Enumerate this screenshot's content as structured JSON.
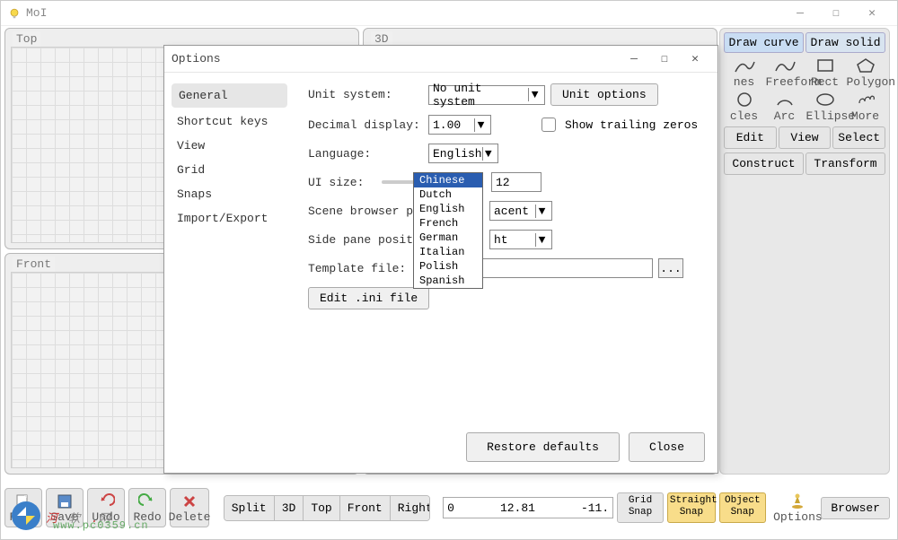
{
  "window": {
    "title": "MoI"
  },
  "viewports": {
    "top": "Top",
    "three_d": "3D",
    "front": "Front"
  },
  "sidepanel": {
    "tabs": {
      "curve": "Draw curve",
      "solid": "Draw solid"
    },
    "shapes1": [
      "nes",
      "Freeform",
      "Rect",
      "Polygon"
    ],
    "shapes2": [
      "cles",
      "Arc",
      "Ellipse",
      "More"
    ],
    "actions": {
      "edit": "Edit",
      "view": "View",
      "select": "Select",
      "construct": "Construct",
      "transform": "Transform"
    }
  },
  "bottombar": {
    "icons": [
      "File",
      "Save",
      "Undo",
      "Redo",
      "Delete"
    ],
    "views": [
      "Split",
      "3D",
      "Top",
      "Front",
      "Right"
    ],
    "coords": {
      "a": "0",
      "b": "12.81",
      "c": "-11."
    },
    "snaps": {
      "grid": "Grid\nSnap",
      "straight": "Straight\nSnap",
      "object": "Object\nSnap"
    },
    "options": "Options",
    "browser": "Browser"
  },
  "dialog": {
    "title": "Options",
    "nav": [
      "General",
      "Shortcut keys",
      "View",
      "Grid",
      "Snaps",
      "Import/Export"
    ],
    "fields": {
      "unit_system": {
        "label": "Unit system:",
        "value": "No unit system",
        "button": "Unit options"
      },
      "decimal": {
        "label": "Decimal display:",
        "value": "1.00",
        "trailing": "Show trailing zeros"
      },
      "language": {
        "label": "Language:",
        "value": "English",
        "options": [
          "Chinese",
          "Dutch",
          "English",
          "French",
          "German",
          "Italian",
          "Polish",
          "Spanish"
        ]
      },
      "ui_size": {
        "label": "UI size:",
        "value": "12"
      },
      "scene_browser": {
        "label": "Scene browser pos",
        "value": "acent"
      },
      "side_pane": {
        "label": "Side pane positio",
        "value": "ht"
      },
      "template": {
        "label": "Template file:",
        "value": ""
      },
      "edit_ini": "Edit .ini file"
    },
    "footer": {
      "restore": "Restore defaults",
      "close": "Close"
    }
  },
  "watermark": {
    "text1": "河",
    "text2": "软",
    "text3": "网",
    "url": "www.pc0359.cn"
  }
}
